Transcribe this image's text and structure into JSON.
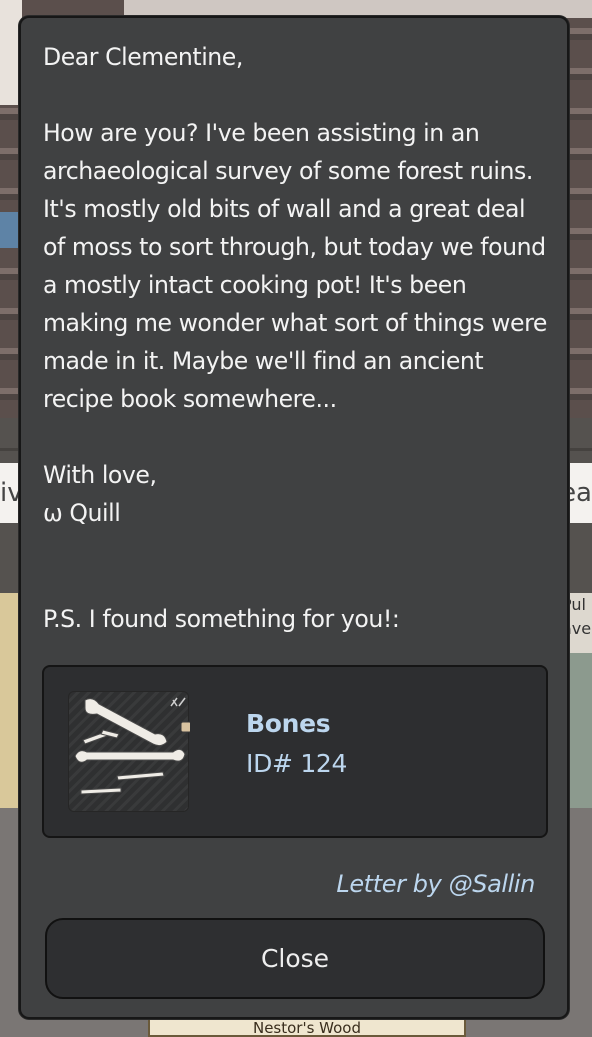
{
  "background": {
    "nav_left_text": "iv",
    "nav_right_text": "ea",
    "map_right_text_1": "Pul",
    "map_right_text_2": "ave",
    "location_label": "Nestor's Wood"
  },
  "letter": {
    "greeting": "Dear Clementine,",
    "body": "How are you? I've been assisting in an archaeological survey of some forest ruins. It's mostly old bits of wall and a great deal of moss to sort through, but today we found a mostly intact cooking pot! It's been making me wonder what sort of things were made in it. Maybe we'll find an ancient recipe book somewhere...",
    "signoff": "With love,",
    "signature": "ω Quill",
    "ps": "P.S. I found something for you!:",
    "credit": "Letter by @Sallin"
  },
  "item": {
    "name": "Bones",
    "id_label": "ID# 124",
    "icon": "bones-icon"
  },
  "buttons": {
    "close_label": "Close"
  },
  "colors": {
    "modal_bg": "#404142",
    "card_bg": "#2d2e30",
    "accent_text": "#bcd6ee",
    "text": "#f3f3f3"
  }
}
